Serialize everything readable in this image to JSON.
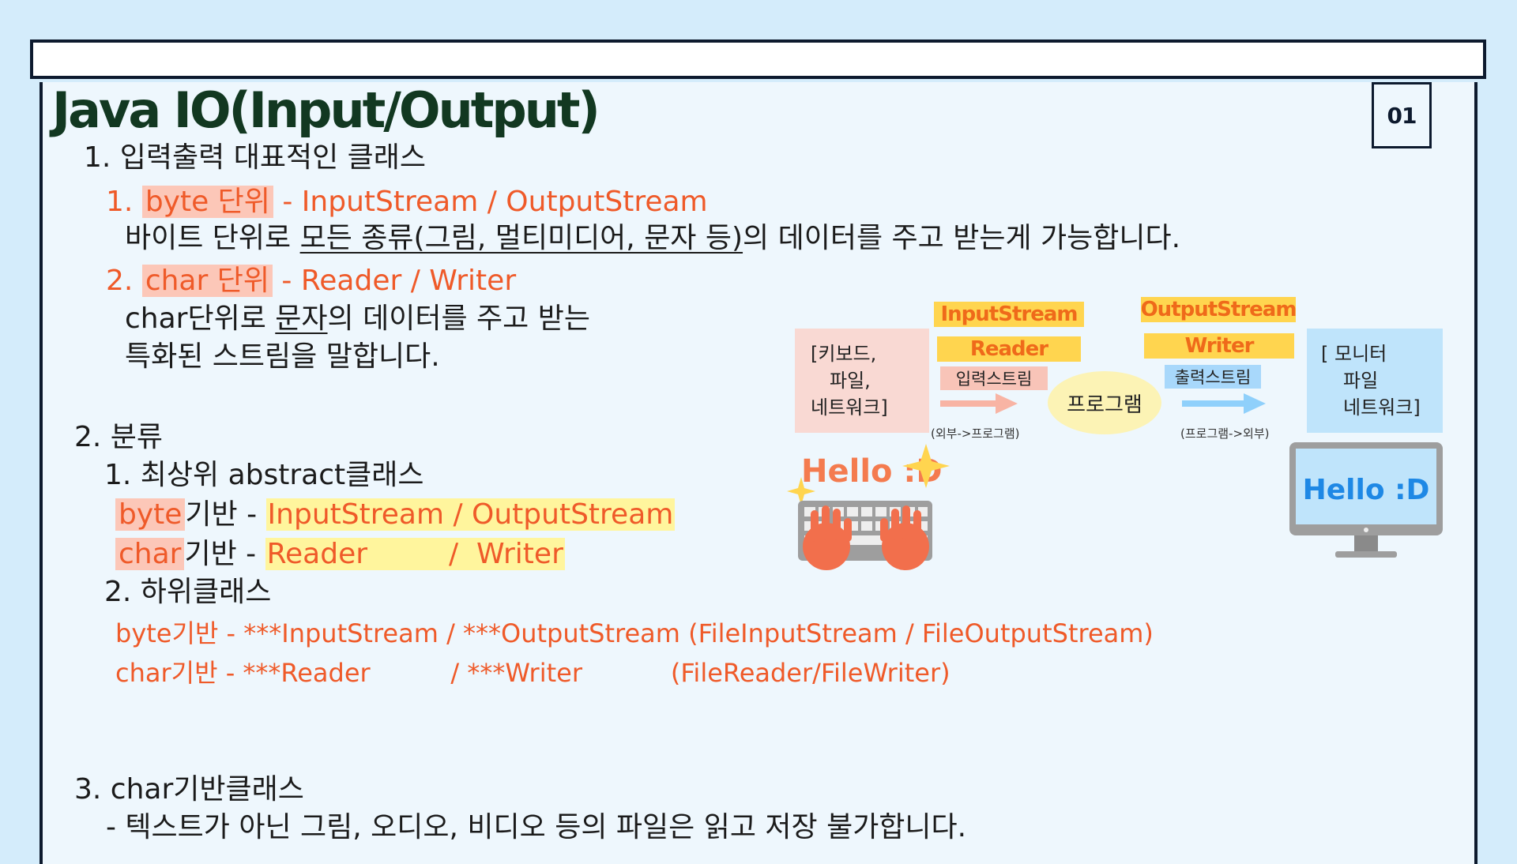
{
  "header": {
    "title": "Java IO(Input/Output)",
    "page_number": "01"
  },
  "section1": {
    "heading": "1. 입력출력 대표적인 클래스",
    "item1": {
      "num": "1.",
      "unit": "byte 단위",
      "classes": "- InputStream / OutputStream",
      "desc_a": "바이트 단위로 ",
      "desc_u": "모든 종류(그림, 멀티미디어, 문자 등)",
      "desc_b": "의 데이터를 주고 받는게 가능합니다."
    },
    "item2": {
      "num": "2.",
      "unit": "char 단위",
      "classes": "- Reader / Writer",
      "desc1_a": "char단위로  ",
      "desc1_u": "문자",
      "desc1_b": "의 데이터를 주고 받는",
      "desc2": "특화된 스트림을 말합니다."
    }
  },
  "section2": {
    "heading": "2. 분류",
    "sub1": {
      "heading": "1. 최상위 abstract클래스",
      "row1_kw": "byte",
      "row1_mid": "기반 - ",
      "row1_classes": "InputStream / OutputStream",
      "row2_kw": "char",
      "row2_mid": "기반 - ",
      "row2_classes": "Reader         /  Writer"
    },
    "sub2": {
      "heading": "2. 하위클래스",
      "row1": "byte기반 - ***InputStream / ***OutputStream (FileInputStream / FileOutputStream)",
      "row2": "char기반 - ***Reader          / ***Writer           (FileReader/FileWriter)"
    }
  },
  "section3": {
    "heading": "3. char기반클래스",
    "desc": "- 텍스트가 아닌 그림, 오디오, 비디오 등의 파일은 읽고 저장 불가합니다."
  },
  "diagram": {
    "source_box": [
      "[키보드,",
      "파일,",
      "네트워크]"
    ],
    "input_stream": "InputStream",
    "reader": "Reader",
    "input_label": "입력스트림",
    "input_note": "(외부->프로그램)",
    "program": "프로그램",
    "output_stream": "OutputStream",
    "writer": "Writer",
    "output_label": "출력스트림",
    "output_note": "(프로그램->외부)",
    "dest_box": [
      "[ 모니터",
      "파일",
      "네트워크]"
    ],
    "keyboard_text": "Hello :D",
    "monitor_text": "Hello :D",
    "colors": {
      "accent_orange": "#ef5a29",
      "label_yellow": "#ffd54f",
      "arrow_pink": "#f8b4a4",
      "arrow_blue": "#8fd0fb"
    }
  }
}
